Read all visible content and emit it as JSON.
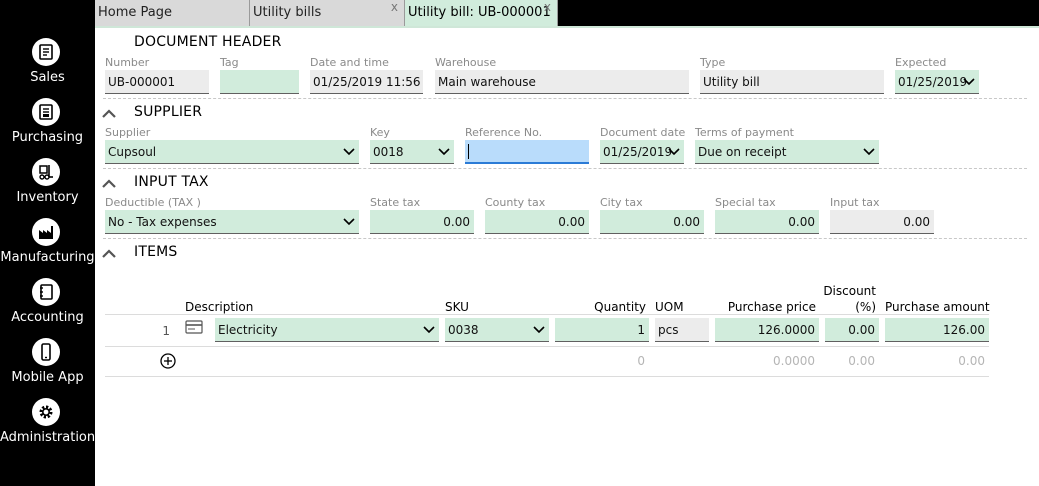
{
  "nav": {
    "items": [
      {
        "label": "Sales",
        "icon": "sales-icon"
      },
      {
        "label": "Purchasing",
        "icon": "purchasing-icon"
      },
      {
        "label": "Inventory",
        "icon": "inventory-icon"
      },
      {
        "label": "Manufacturing",
        "icon": "manufacturing-icon"
      },
      {
        "label": "Accounting",
        "icon": "accounting-icon"
      },
      {
        "label": "Mobile App",
        "icon": "mobile-app-icon"
      },
      {
        "label": "Administration",
        "icon": "gear-icon"
      }
    ]
  },
  "tabs": [
    {
      "label": "Home Page",
      "closable": false
    },
    {
      "label": "Utility bills",
      "close": "x"
    },
    {
      "label": "Utility bill: UB-000001",
      "close": "x",
      "active": true
    }
  ],
  "header": {
    "title": "DOCUMENT HEADER",
    "number_label": "Number",
    "number_value": "UB-000001",
    "tag_label": "Tag",
    "tag_value": "",
    "datetime_label": "Date and time",
    "datetime_value": "01/25/2019 11:56",
    "warehouse_label": "Warehouse",
    "warehouse_value": "Main warehouse",
    "type_label": "Type",
    "type_value": "Utility bill",
    "expected_label": "Expected",
    "expected_value": "01/25/2019"
  },
  "supplier": {
    "title": "SUPPLIER",
    "supplier_label": "Supplier",
    "supplier_value": "Cupsoul",
    "key_label": "Key",
    "key_value": "0018",
    "reference_label": "Reference No.",
    "reference_value": "",
    "docdate_label": "Document date",
    "docdate_value": "01/25/2019",
    "terms_label": "Terms of payment",
    "terms_value": "Due on receipt"
  },
  "input_tax": {
    "title": "INPUT TAX",
    "deductible_label": "Deductible (TAX )",
    "deductible_value": "No - Tax expenses",
    "state_label": "State tax",
    "state_value": "0.00",
    "county_label": "County tax",
    "county_value": "0.00",
    "city_label": "City tax",
    "city_value": "0.00",
    "special_label": "Special tax",
    "special_value": "0.00",
    "input_label": "Input tax",
    "input_value": "0.00"
  },
  "items": {
    "title": "ITEMS",
    "columns": {
      "description": "Description",
      "sku": "SKU",
      "quantity": "Quantity",
      "uom": "UOM",
      "price": "Purchase price",
      "discount_line1": "Discount",
      "discount_line2": "(%)",
      "amount": "Purchase amount"
    },
    "rows": [
      {
        "no": "1",
        "description": "Electricity",
        "sku": "0038",
        "quantity": "1",
        "uom": "pcs",
        "price": "126.0000",
        "discount": "0.00",
        "amount": "126.00"
      }
    ],
    "totals": {
      "quantity": "0",
      "price": "0.0000",
      "discount": "0.00",
      "amount": "0.00"
    }
  },
  "colors": {
    "editable": "#d1ecdc",
    "readonly": "#ececec",
    "focus": "#b9dcfb",
    "sidebar": "#000000"
  }
}
